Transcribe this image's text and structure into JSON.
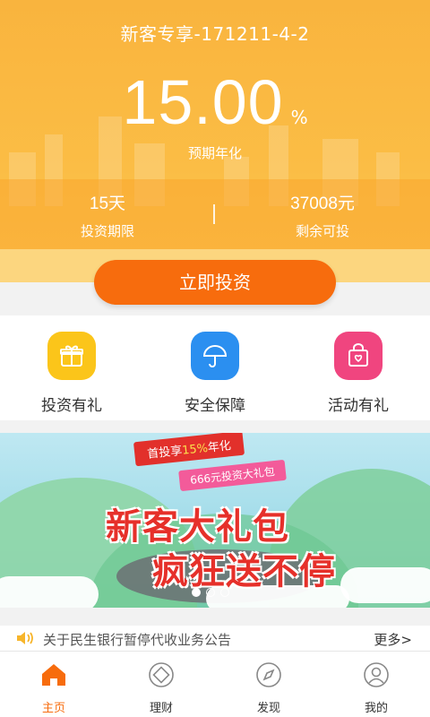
{
  "hero": {
    "title": "新客专享-171211-4-2",
    "rate": "15.00",
    "rate_unit": "%",
    "rate_label": "预期年化",
    "term_value": "15天",
    "term_label": "投资期限",
    "remain_value": "37008元",
    "remain_label": "剩余可投",
    "separator": "|"
  },
  "cta": {
    "invest_label": "立即投资"
  },
  "features": [
    {
      "label": "投资有礼",
      "icon": "gift-icon",
      "color": "#fbc51a"
    },
    {
      "label": "安全保障",
      "icon": "umbrella-icon",
      "color": "#2b8ff0"
    },
    {
      "label": "活动有礼",
      "icon": "shopping-bag-icon",
      "color": "#f0457f"
    }
  ],
  "banner": {
    "ribbon1_prefix": "首投享",
    "ribbon1_highlight": "15%",
    "ribbon1_suffix": "年化",
    "ribbon2": "666元投资大礼包",
    "headline1": "新客大礼包",
    "headline2": "疯狂送不停",
    "page_count": 3,
    "active_page": 1
  },
  "notice": {
    "icon": "speaker-icon",
    "text": "关于民生银行暂停代收业务公告",
    "more": "更多>"
  },
  "tabs": [
    {
      "label": "主页",
      "icon": "home-icon",
      "active": true
    },
    {
      "label": "理财",
      "icon": "wealth-icon",
      "active": false
    },
    {
      "label": "发现",
      "icon": "compass-icon",
      "active": false
    },
    {
      "label": "我的",
      "icon": "user-icon",
      "active": false
    }
  ],
  "colors": {
    "accent": "#f76c0d",
    "hero": "#f9b43e",
    "banner_text": "#e6302a"
  }
}
